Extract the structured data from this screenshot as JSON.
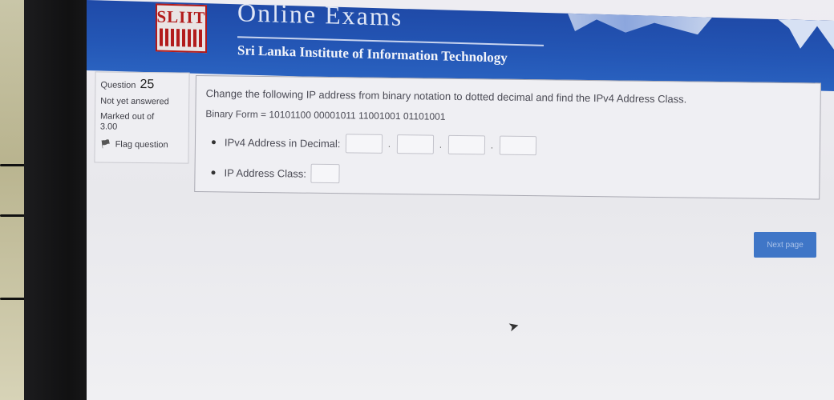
{
  "header": {
    "logo_text": "SLIIT",
    "title": "Online Exams",
    "subtitle": "Sri Lanka Institute of Information Technology"
  },
  "question_info": {
    "label": "Question",
    "number": "25",
    "status": "Not yet answered",
    "marked_out_of": "Marked out of",
    "marks": "3.00",
    "flag_label": "Flag question"
  },
  "question": {
    "text": "Change the following IP address from binary notation to dotted decimal and find the IPv4 Address Class.",
    "binary_form": "Binary Form =  10101100 00001011 11001001 01101001",
    "decimal_label": "IPv4 Address in Decimal:",
    "octet_separator": ".",
    "octets": [
      "",
      "",
      "",
      ""
    ],
    "class_label": "IP Address Class:",
    "class_value": ""
  },
  "navigation": {
    "next_label": "Next page"
  },
  "colors": {
    "header_blue": "#2457b6",
    "logo_red": "#b21b1b",
    "button_blue": "#3f76c7"
  },
  "icons": {
    "flag": "flag-icon",
    "cursor": "mouse-pointer-icon"
  }
}
